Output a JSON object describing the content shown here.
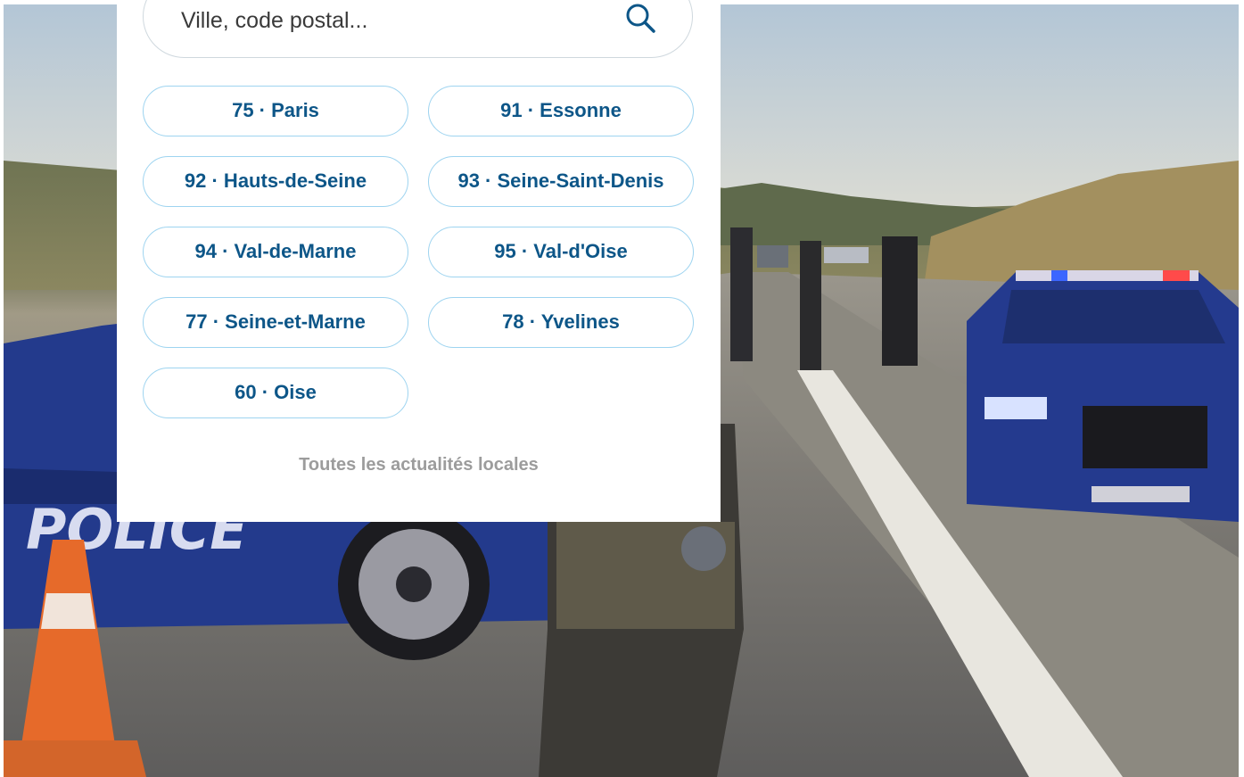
{
  "search": {
    "placeholder": "Ville, code postal...",
    "icon": "search-icon"
  },
  "departments": [
    {
      "label": "75 · Paris"
    },
    {
      "label": "91 · Essonne"
    },
    {
      "label": "92 · Hauts-de-Seine"
    },
    {
      "label": "93 · Seine-Saint-Denis"
    },
    {
      "label": "94 · Val-de-Marne"
    },
    {
      "label": "95 · Val-d'Oise"
    },
    {
      "label": "77 · Seine-et-Marne"
    },
    {
      "label": "78 · Yvelines"
    },
    {
      "label": "60 · Oise"
    }
  ],
  "footer_link": "Toutes les actualités locales",
  "background": {
    "vehicle_text": "POLICE"
  },
  "colors": {
    "button_text": "#0d5688",
    "button_border": "#9ed4f0",
    "link_text": "#9c9c9c",
    "police_blue": "#233a8c"
  }
}
